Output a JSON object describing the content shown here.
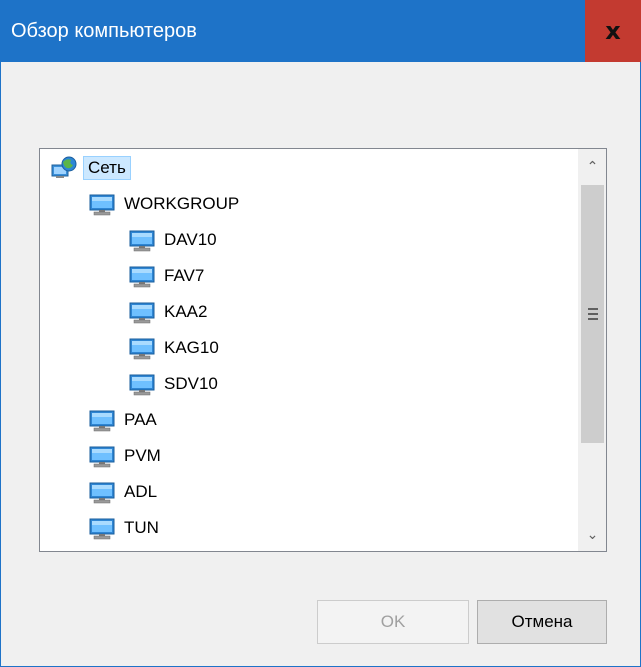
{
  "window": {
    "title": "Обзор компьютеров",
    "close_glyph": "x"
  },
  "tree": {
    "root": {
      "label": "Сеть",
      "icon": "network-globe-icon",
      "selected": true
    },
    "workgroup": {
      "label": "WORKGROUP",
      "icon": "computer-icon",
      "children": [
        "DAV10",
        "FAV7",
        "KAA2",
        "KAG10",
        "SDV10"
      ]
    },
    "computers": [
      "PAA",
      "PVM",
      "ADL",
      "TUN"
    ]
  },
  "buttons": {
    "ok": "OK",
    "cancel": "Отмена"
  },
  "colors": {
    "titlebar": "#1e73c8",
    "close": "#c33a30",
    "selection": "#cce8ff"
  }
}
